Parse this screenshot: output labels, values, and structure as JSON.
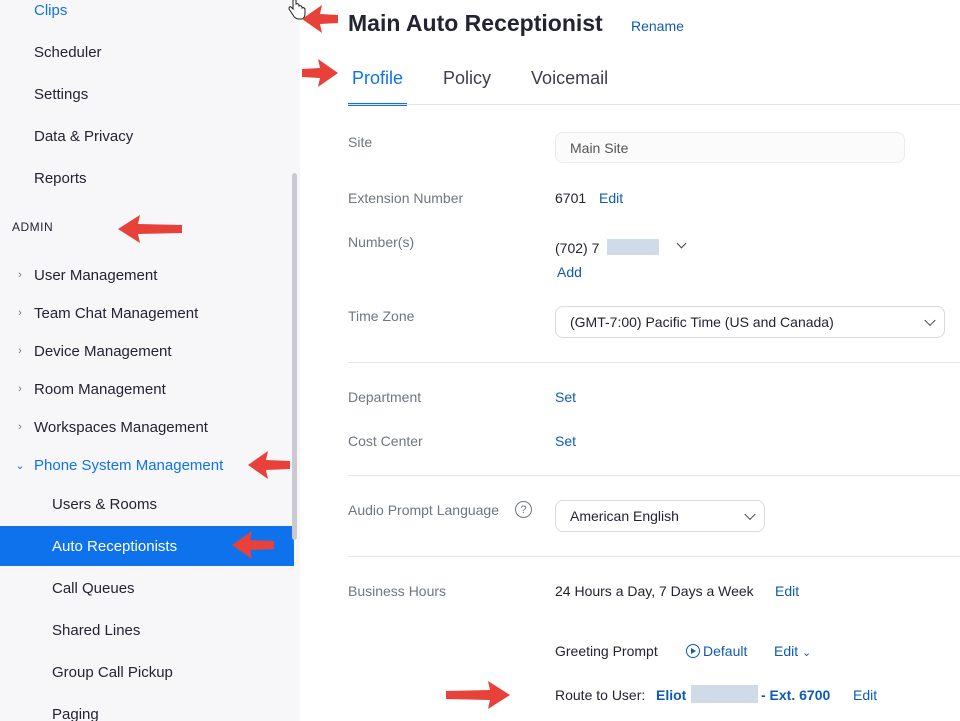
{
  "sidebar": {
    "items_top": [
      {
        "label": "Clips"
      },
      {
        "label": "Scheduler"
      },
      {
        "label": "Settings"
      },
      {
        "label": "Data & Privacy"
      },
      {
        "label": "Reports"
      }
    ],
    "section_admin": "ADMIN",
    "admin_items": [
      {
        "label": "User Management"
      },
      {
        "label": "Team Chat Management"
      },
      {
        "label": "Device Management"
      },
      {
        "label": "Room Management"
      },
      {
        "label": "Workspaces Management"
      },
      {
        "label": "Phone System Management"
      }
    ],
    "phone_sub_items": [
      {
        "label": "Users & Rooms"
      },
      {
        "label": "Auto Receptionists"
      },
      {
        "label": "Call Queues"
      },
      {
        "label": "Shared Lines"
      },
      {
        "label": "Group Call Pickup"
      },
      {
        "label": "Paging"
      }
    ],
    "active_item": "Auto Receptionists"
  },
  "header": {
    "title": "Main Auto Receptionist",
    "rename": "Rename"
  },
  "tabs": [
    {
      "label": "Profile",
      "active": true
    },
    {
      "label": "Policy",
      "active": false
    },
    {
      "label": "Voicemail",
      "active": false
    }
  ],
  "profile": {
    "site_label": "Site",
    "site_value": "Main Site",
    "extension_label": "Extension Number",
    "extension_value": "6701",
    "extension_edit": "Edit",
    "numbers_label": "Number(s)",
    "number_value": "(702) 7",
    "numbers_add": "Add",
    "timezone_label": "Time Zone",
    "timezone_value": "(GMT-7:00) Pacific Time (US and Canada)",
    "department_label": "Department",
    "department_action": "Set",
    "cost_center_label": "Cost Center",
    "cost_center_action": "Set",
    "audio_lang_label": "Audio Prompt Language",
    "audio_lang_help": "?",
    "audio_lang_value": "American English",
    "business_hours_label": "Business Hours",
    "business_hours_value": "24 Hours a Day, 7 Days a Week",
    "business_hours_edit": "Edit",
    "greeting_label": "Greeting Prompt",
    "greeting_value": "Default",
    "greeting_edit": "Edit",
    "route_label": "Route to User:",
    "route_user_first": "Eliot",
    "route_ext": "- Ext. 6700",
    "route_edit": "Edit"
  },
  "colors": {
    "accent": "#0e72ed",
    "link": "#0e5bb5",
    "annotation_arrow": "#e8413a"
  }
}
